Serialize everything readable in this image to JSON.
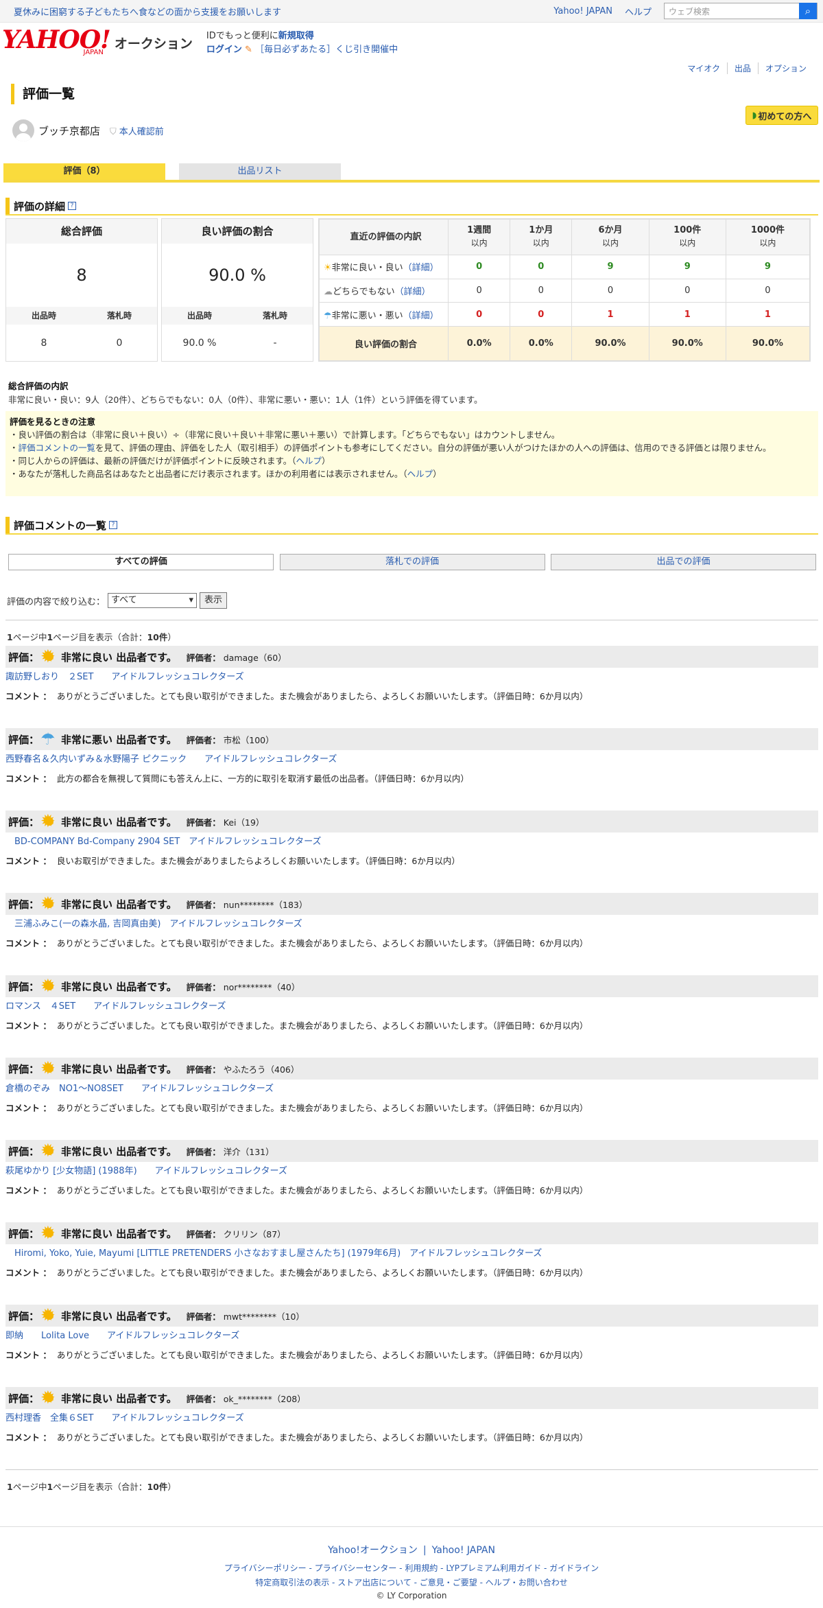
{
  "topbar": {
    "promo": "夏休みに困窮する子どもたちへ食などの面から支援をお願いします",
    "yahoo_japan": "Yahoo! JAPAN",
    "help": "ヘルプ",
    "search_placeholder": "ウェブ検索"
  },
  "header": {
    "logo": "YAHOO!",
    "logo_sub": "JAPAN",
    "service": "オークション",
    "id_text": "IDでもっと便利に",
    "id_link": "新規取得",
    "login": "ログイン",
    "lottery": "［毎日必ずあたる］くじ引き開催中"
  },
  "subnav": [
    "マイオク",
    "出品",
    "オプション"
  ],
  "page_title": "評価一覧",
  "first_time": "初めての方へ",
  "user": {
    "name": "ブッチ京都店",
    "verify": "本人確認前"
  },
  "tabs": {
    "rating": "評価（8）",
    "listing": "出品リスト"
  },
  "detail": {
    "title": "評価の詳細",
    "total": {
      "h": "総合評価",
      "value": "8",
      "sub1": "出品時",
      "sub2": "落札時",
      "v1": "8",
      "v2": "0"
    },
    "ratio": {
      "h": "良い評価の割合",
      "value": "90.0 %",
      "sub1": "出品時",
      "sub2": "落札時",
      "v1": "90.0 %",
      "v2": "-"
    },
    "recent": {
      "h": "直近の評価の内訳",
      "cols": [
        {
          "a": "1週間",
          "b": "以内"
        },
        {
          "a": "1か月",
          "b": "以内"
        },
        {
          "a": "6か月",
          "b": "以内"
        },
        {
          "a": "100件",
          "b": "以内"
        },
        {
          "a": "1000件",
          "b": "以内"
        }
      ],
      "rows": [
        {
          "label": "非常に良い・良い",
          "detail": "（詳細）",
          "vals": [
            "0",
            "0",
            "9",
            "9",
            "9"
          ]
        },
        {
          "label": "どちらでもない",
          "detail": "（詳細）",
          "vals": [
            "0",
            "0",
            "0",
            "0",
            "0"
          ]
        },
        {
          "label": "非常に悪い・悪い",
          "detail": "（詳細）",
          "vals": [
            "0",
            "0",
            "1",
            "1",
            "1"
          ]
        }
      ],
      "ratio_label": "良い評価の割合",
      "ratio_vals": [
        "0.0%",
        "0.0%",
        "90.0%",
        "90.0%",
        "90.0%"
      ]
    }
  },
  "breakdown": {
    "title": "総合評価の内訳",
    "text": "非常に良い・良い：9人（20件）、どちらでもない：0人（0件）、非常に悪い・悪い：1人（1件）という評価を得ています。"
  },
  "notice": {
    "title": "評価を見るときの注意",
    "l1": "・良い評価の割合は（非常に良い＋良い）÷（非常に良い＋良い＋非常に悪い＋悪い）で計算します。「どちらでもない」はカウントしません。",
    "l2a": "・",
    "l2link": "評価コメントの一覧",
    "l2b": "を見て、評価の理由、評価をした人（取引相手）の評価ポイントも参考にしてください。自分の評価が悪い人がつけたほかの人への評価は、信用のできる評価とは限りません。",
    "l3a": "・同じ人からの評価は、最新の評価だけが評価ポイントに反映されます。（",
    "l3link": "ヘルプ",
    "l3b": "）",
    "l4a": "・あなたが落札した商品名はあなたと出品者にだけ表示されます。ほかの利用者には表示されません。（",
    "l4link": "ヘルプ",
    "l4b": "）"
  },
  "comments": {
    "title": "評価コメントの一覧",
    "filters": [
      "すべての評価",
      "落札での評価",
      "出品での評価"
    ],
    "narrow_label": "評価の内容で絞り込む：",
    "narrow_value": "すべて",
    "show": "表示",
    "pager_a": "1",
    "pager_b": "ページ中",
    "pager_c": "1",
    "pager_d": "ページ目を表示（合計：",
    "pager_e": "10件",
    "pager_f": "）",
    "label_rating": "評価：",
    "label_rater": "評価者：",
    "label_comment": "コメント ：",
    "entries": [
      {
        "icon": "sun",
        "type": "非常に良い 出品者です。",
        "rater": "damage（60）",
        "item": "諏訪野しおり　２SET　　アイドルフレッシュコレクターズ",
        "comment": "ありがとうございました。とても良い取引ができました。また機会がありましたら、よろしくお願いいたします。（評価日時：6か月以内）"
      },
      {
        "icon": "umbrella",
        "type": "非常に悪い 出品者です。",
        "rater": "市松（100）",
        "item": "西野春名＆久内いずみ＆水野陽子 ピクニック　　アイドルフレッシュコレクターズ",
        "comment": "此方の都合を無視して質問にも答えん上に、一方的に取引を取消す最低の出品者。（評価日時：6か月以内）"
      },
      {
        "icon": "sun",
        "type": "非常に良い 出品者です。",
        "rater": "Kei（19）",
        "item": "　BD-COMPANY Bd-Company 2904 SET　アイドルフレッシュコレクターズ",
        "comment": "良いお取引ができました。また機会がありましたらよろしくお願いいたします。（評価日時：6か月以内）"
      },
      {
        "icon": "sun",
        "type": "非常に良い 出品者です。",
        "rater": "nun********（183）",
        "item": "　三浦ふみこ(一の森水晶, 吉岡真由美)　アイドルフレッシュコレクターズ",
        "comment": "ありがとうございました。とても良い取引ができました。また機会がありましたら、よろしくお願いいたします。（評価日時：6か月以内）"
      },
      {
        "icon": "sun",
        "type": "非常に良い 出品者です。",
        "rater": "nor********（40）",
        "item": "ロマンス　４SET　　アイドルフレッシュコレクターズ",
        "comment": "ありがとうございました。とても良い取引ができました。また機会がありましたら、よろしくお願いいたします。（評価日時：6か月以内）"
      },
      {
        "icon": "sun",
        "type": "非常に良い 出品者です。",
        "rater": "やふたろう（406）",
        "item": "倉橋のぞみ　NO1〜NO8SET　　アイドルフレッシュコレクターズ",
        "comment": "ありがとうございました。とても良い取引ができました。また機会がありましたら、よろしくお願いいたします。（評価日時：6か月以内）"
      },
      {
        "icon": "sun",
        "type": "非常に良い 出品者です。",
        "rater": "洋介（131）",
        "item": "萩尾ゆかり [少女物語] (1988年)　　アイドルフレッシュコレクターズ",
        "comment": "ありがとうございました。とても良い取引ができました。また機会がありましたら、よろしくお願いいたします。（評価日時：6か月以内）"
      },
      {
        "icon": "sun",
        "type": "非常に良い 出品者です。",
        "rater": "クリリン（87）",
        "item": "　Hiromi, Yoko, Yuie, Mayumi [LITTLE PRETENDERS 小さなおすまし屋さんたち] (1979年6月)　アイドルフレッシュコレクターズ",
        "comment": "ありがとうございました。とても良い取引ができました。また機会がありましたら、よろしくお願いいたします。（評価日時：6か月以内）"
      },
      {
        "icon": "sun",
        "type": "非常に良い 出品者です。",
        "rater": "mwt********（10）",
        "item": "即納　　Lolita Love　　アイドルフレッシュコレクターズ",
        "comment": "ありがとうございました。とても良い取引ができました。また機会がありましたら、よろしくお願いいたします。（評価日時：6か月以内）"
      },
      {
        "icon": "sun",
        "type": "非常に良い 出品者です。",
        "rater": "ok_********（208）",
        "item": "西村理香　全集６SET　　アイドルフレッシュコレクターズ",
        "comment": "ありがとうございました。とても良い取引ができました。また機会がありましたら、よろしくお願いいたします。（評価日時：6か月以内）"
      }
    ]
  },
  "footer": {
    "links1": [
      "Yahoo!オークション",
      "Yahoo! JAPAN"
    ],
    "sep": "|",
    "links2": [
      "プライバシーポリシー",
      "プライバシーセンター",
      "利用規約",
      "LYPプレミアム利用ガイド",
      "ガイドライン"
    ],
    "links3": [
      "特定商取引法の表示",
      "ストア出店について",
      "ご意見・ご要望",
      "ヘルプ・お問い合わせ"
    ],
    "dot": " - ",
    "copyright": "© LY Corporation"
  }
}
